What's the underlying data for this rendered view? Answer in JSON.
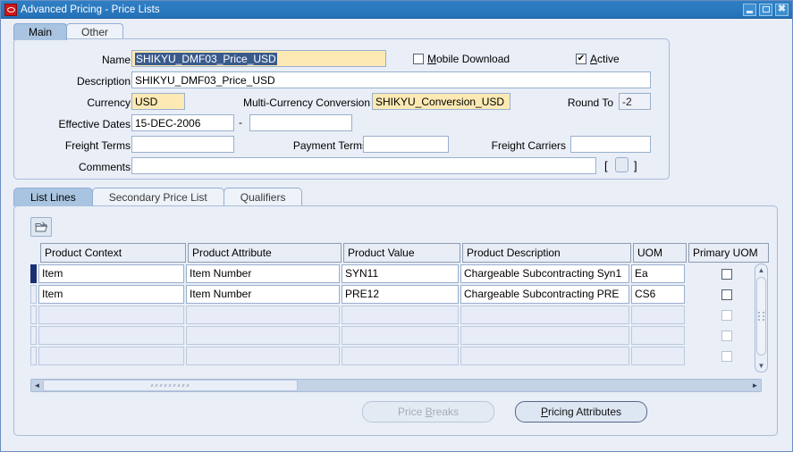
{
  "window": {
    "title": "Advanced Pricing - Price Lists",
    "app_icon": "oracle-icon",
    "minimize": "minimize-icon",
    "maximize": "maximize-icon",
    "close": "close-icon"
  },
  "top_tabs": [
    {
      "label": "Main",
      "active": true
    },
    {
      "label": "Other",
      "active": false
    }
  ],
  "main_form": {
    "name": {
      "label": "Name",
      "value": "SHIKYU_DMF03_Price_USD",
      "selected": true,
      "required": true
    },
    "description": {
      "label": "Description",
      "value": "SHIKYU_DMF03_Price_USD"
    },
    "mobile_download": {
      "label": "Mobile Download",
      "accel": "M",
      "checked": false,
      "mark": ""
    },
    "active": {
      "label": "Active",
      "accel": "A",
      "checked": true,
      "mark": "✔"
    },
    "currency": {
      "label": "Currency",
      "value": "USD",
      "required": true
    },
    "multi_currency_conversion": {
      "label": "Multi-Currency Conversion",
      "value": "SHIKYU_Conversion_USD",
      "required": true
    },
    "round_to": {
      "label": "Round To",
      "value": "-2"
    },
    "effective_dates": {
      "label": "Effective Dates",
      "from": "15-DEC-2006",
      "to": "",
      "separator": "-"
    },
    "freight_terms": {
      "label": "Freight Terms",
      "value": ""
    },
    "payment_terms": {
      "label": "Payment Terms",
      "value": ""
    },
    "freight_carriers": {
      "label": "Freight Carriers",
      "value": ""
    },
    "comments": {
      "label": "Comments",
      "value": ""
    },
    "bracket_open": "[",
    "bracket_close": "]"
  },
  "lower_tabs": [
    {
      "label": "List Lines",
      "active": true
    },
    {
      "label": "Secondary Price List",
      "active": false
    },
    {
      "label": "Qualifiers",
      "active": false
    }
  ],
  "grid_toolbar": {
    "edit_button": "edit-folder-icon"
  },
  "grid": {
    "columns": [
      "Product Context",
      "Product Attribute",
      "Product Value",
      "Product Description",
      "UOM",
      "Primary UOM"
    ],
    "rows": [
      {
        "selected": true,
        "cells": [
          "Item",
          "Item Number",
          "SYN11",
          "Chargeable Subcontracting Syn1",
          "Ea"
        ],
        "primary_uom": false,
        "empty": false
      },
      {
        "selected": false,
        "cells": [
          "Item",
          "Item Number",
          "PRE12",
          "Chargeable Subcontracting PRE",
          "CS6"
        ],
        "primary_uom": false,
        "empty": false
      },
      {
        "selected": false,
        "cells": [
          "",
          "",
          "",
          "",
          ""
        ],
        "primary_uom": false,
        "empty": true
      },
      {
        "selected": false,
        "cells": [
          "",
          "",
          "",
          "",
          ""
        ],
        "primary_uom": false,
        "empty": true
      },
      {
        "selected": false,
        "cells": [
          "",
          "",
          "",
          "",
          ""
        ],
        "primary_uom": false,
        "empty": true
      }
    ]
  },
  "scrollbars": {
    "vertical": {
      "up": "▲",
      "down": "▼"
    },
    "horizontal": {
      "left": "◄",
      "right": "►"
    }
  },
  "actions": {
    "price_breaks": {
      "label_pre": "Price ",
      "accel": "B",
      "label_post": "reaks",
      "enabled": false
    },
    "pricing_attributes": {
      "label_pre": "",
      "accel": "P",
      "label_post": "ricing Attributes",
      "enabled": true
    }
  },
  "colors": {
    "title_bar": "#2b79bf",
    "required_field": "#fde9b4",
    "selection": "#3a5a8c",
    "row_indicator": "#1a2f72",
    "active_tab": "#a9c4e0",
    "panel_bg": "#e9eef7"
  }
}
